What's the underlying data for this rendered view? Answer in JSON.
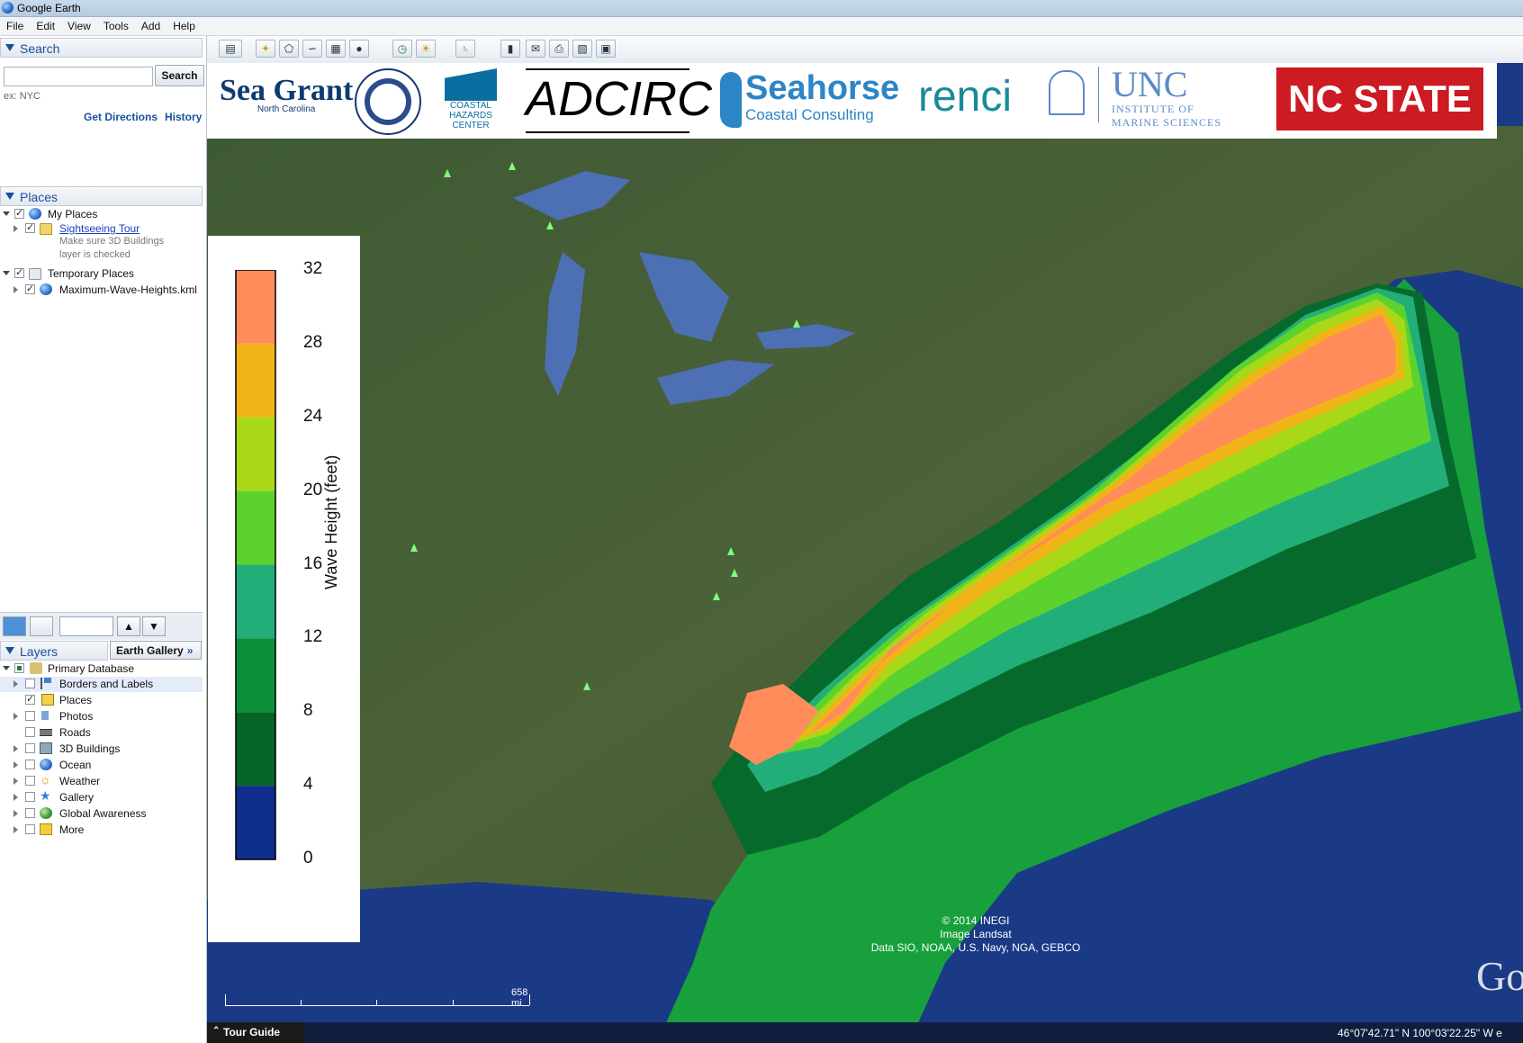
{
  "window": {
    "title": "Google Earth"
  },
  "menu": [
    "File",
    "Edit",
    "View",
    "Tools",
    "Add",
    "Help"
  ],
  "search_panel": {
    "header": "Search",
    "input_value": "",
    "button_label": "Search",
    "hint": "ex: NYC",
    "get_directions": "Get Directions",
    "history": "History"
  },
  "places_panel": {
    "header": "Places",
    "items": [
      {
        "label": "My Places",
        "checked": true
      },
      {
        "label": "Sightseeing Tour",
        "checked": true,
        "note1": "Make sure 3D Buildings",
        "note2": "layer is checked"
      },
      {
        "label": "Temporary Places",
        "checked": true
      },
      {
        "label": "Maximum-Wave-Heights.kml",
        "checked": true
      }
    ]
  },
  "layers_panel": {
    "header": "Layers",
    "gallery_button": "Earth Gallery",
    "items": [
      {
        "label": "Primary Database"
      },
      {
        "label": "Borders and Labels",
        "checked": false
      },
      {
        "label": "Places",
        "checked": true
      },
      {
        "label": "Photos",
        "checked": false
      },
      {
        "label": "Roads",
        "checked": false
      },
      {
        "label": "3D Buildings",
        "checked": false
      },
      {
        "label": "Ocean",
        "checked": false
      },
      {
        "label": "Weather",
        "checked": false
      },
      {
        "label": "Gallery",
        "checked": false
      },
      {
        "label": "Global Awareness",
        "checked": false
      },
      {
        "label": "More",
        "checked": false
      }
    ]
  },
  "banner_logos": {
    "seagrant": "Sea Grant",
    "seagrant_sub": "North Carolina",
    "coastal1": "COASTAL",
    "coastal2": "HAZARDS",
    "coastal3": "CENTER",
    "adcirc": "ADCIRC",
    "seahorse": "Seahorse",
    "seahorse_sub": "Coastal Consulting",
    "renci": "renci",
    "unc": "UNC",
    "unc_sub1": "INSTITUTE OF",
    "unc_sub2": "MARINE SCIENCES",
    "ncstate": "NC STATE"
  },
  "legend": {
    "title": "Wave Height (feet)",
    "ticks": [
      "32",
      "28",
      "24",
      "20",
      "16",
      "12",
      "8",
      "4",
      "0"
    ],
    "colors": [
      "#ff8c5a",
      "#f0b418",
      "#a8d818",
      "#5cd22e",
      "#22ae78",
      "#0a9138",
      "#066428",
      "#0f2d8c"
    ]
  },
  "map": {
    "copyright1": "© 2014 INEGI",
    "copyright2": "Image Landsat",
    "copyright3": "Data SIO, NOAA, U.S. Navy, NGA, GEBCO",
    "scale_label": "658 mi",
    "tour_guide": "Tour Guide",
    "coordinates": "46°07'42.71\" N  100°03'22.25\" W  e",
    "watermark": "Go"
  }
}
